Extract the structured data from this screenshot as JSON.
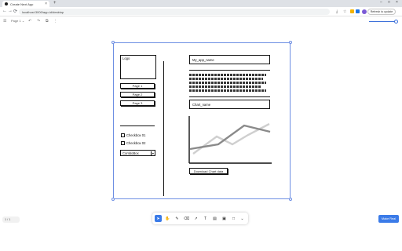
{
  "browser": {
    "tab_title": "Create Next App",
    "tab_close_glyph": "×",
    "new_tab_glyph": "+",
    "window_controls": [
      "–",
      "□",
      "×"
    ],
    "nav": {
      "back": "←",
      "forward": "→",
      "reload": "⟳"
    },
    "url": "localhost:3000/app-id/desktop",
    "refresh_button_label": "Refresh to update",
    "extension_colors": [
      "#f3b300",
      "#1a73e8"
    ]
  },
  "app_toolbar": {
    "menu_icon": "☰",
    "page_label": "Page 1",
    "page_caret": "⌄",
    "actions": [
      "↶",
      "↷",
      "⧉",
      "⋮"
    ]
  },
  "wireframe": {
    "logo_label": "Logo",
    "pages": [
      "Page 1",
      "Page 2",
      "Page 3"
    ],
    "checkboxes": [
      "Checkbox 01",
      "Checkbox 02"
    ],
    "combo_label": "ComboBox",
    "combo_arrow": "▾",
    "app_name": "My_app_name",
    "chart_name": "Chart_name",
    "download_label": "Download Chart data"
  },
  "bottom": {
    "page_indicator": "1 / 1",
    "tools": [
      {
        "name": "cursor-tool",
        "glyph": "➤"
      },
      {
        "name": "hand-tool",
        "glyph": "✋"
      },
      {
        "name": "pen-tool",
        "glyph": "✎"
      },
      {
        "name": "eraser-tool",
        "glyph": "⌫"
      },
      {
        "name": "arrow-tool",
        "glyph": "↗"
      },
      {
        "name": "text-tool",
        "glyph": "T"
      },
      {
        "name": "note-tool",
        "glyph": "▤"
      },
      {
        "name": "image-tool",
        "glyph": "▣"
      },
      {
        "name": "shape-tool",
        "glyph": "□"
      },
      {
        "name": "more-tool",
        "glyph": "⌄"
      }
    ],
    "cta_label": "Make Real"
  }
}
